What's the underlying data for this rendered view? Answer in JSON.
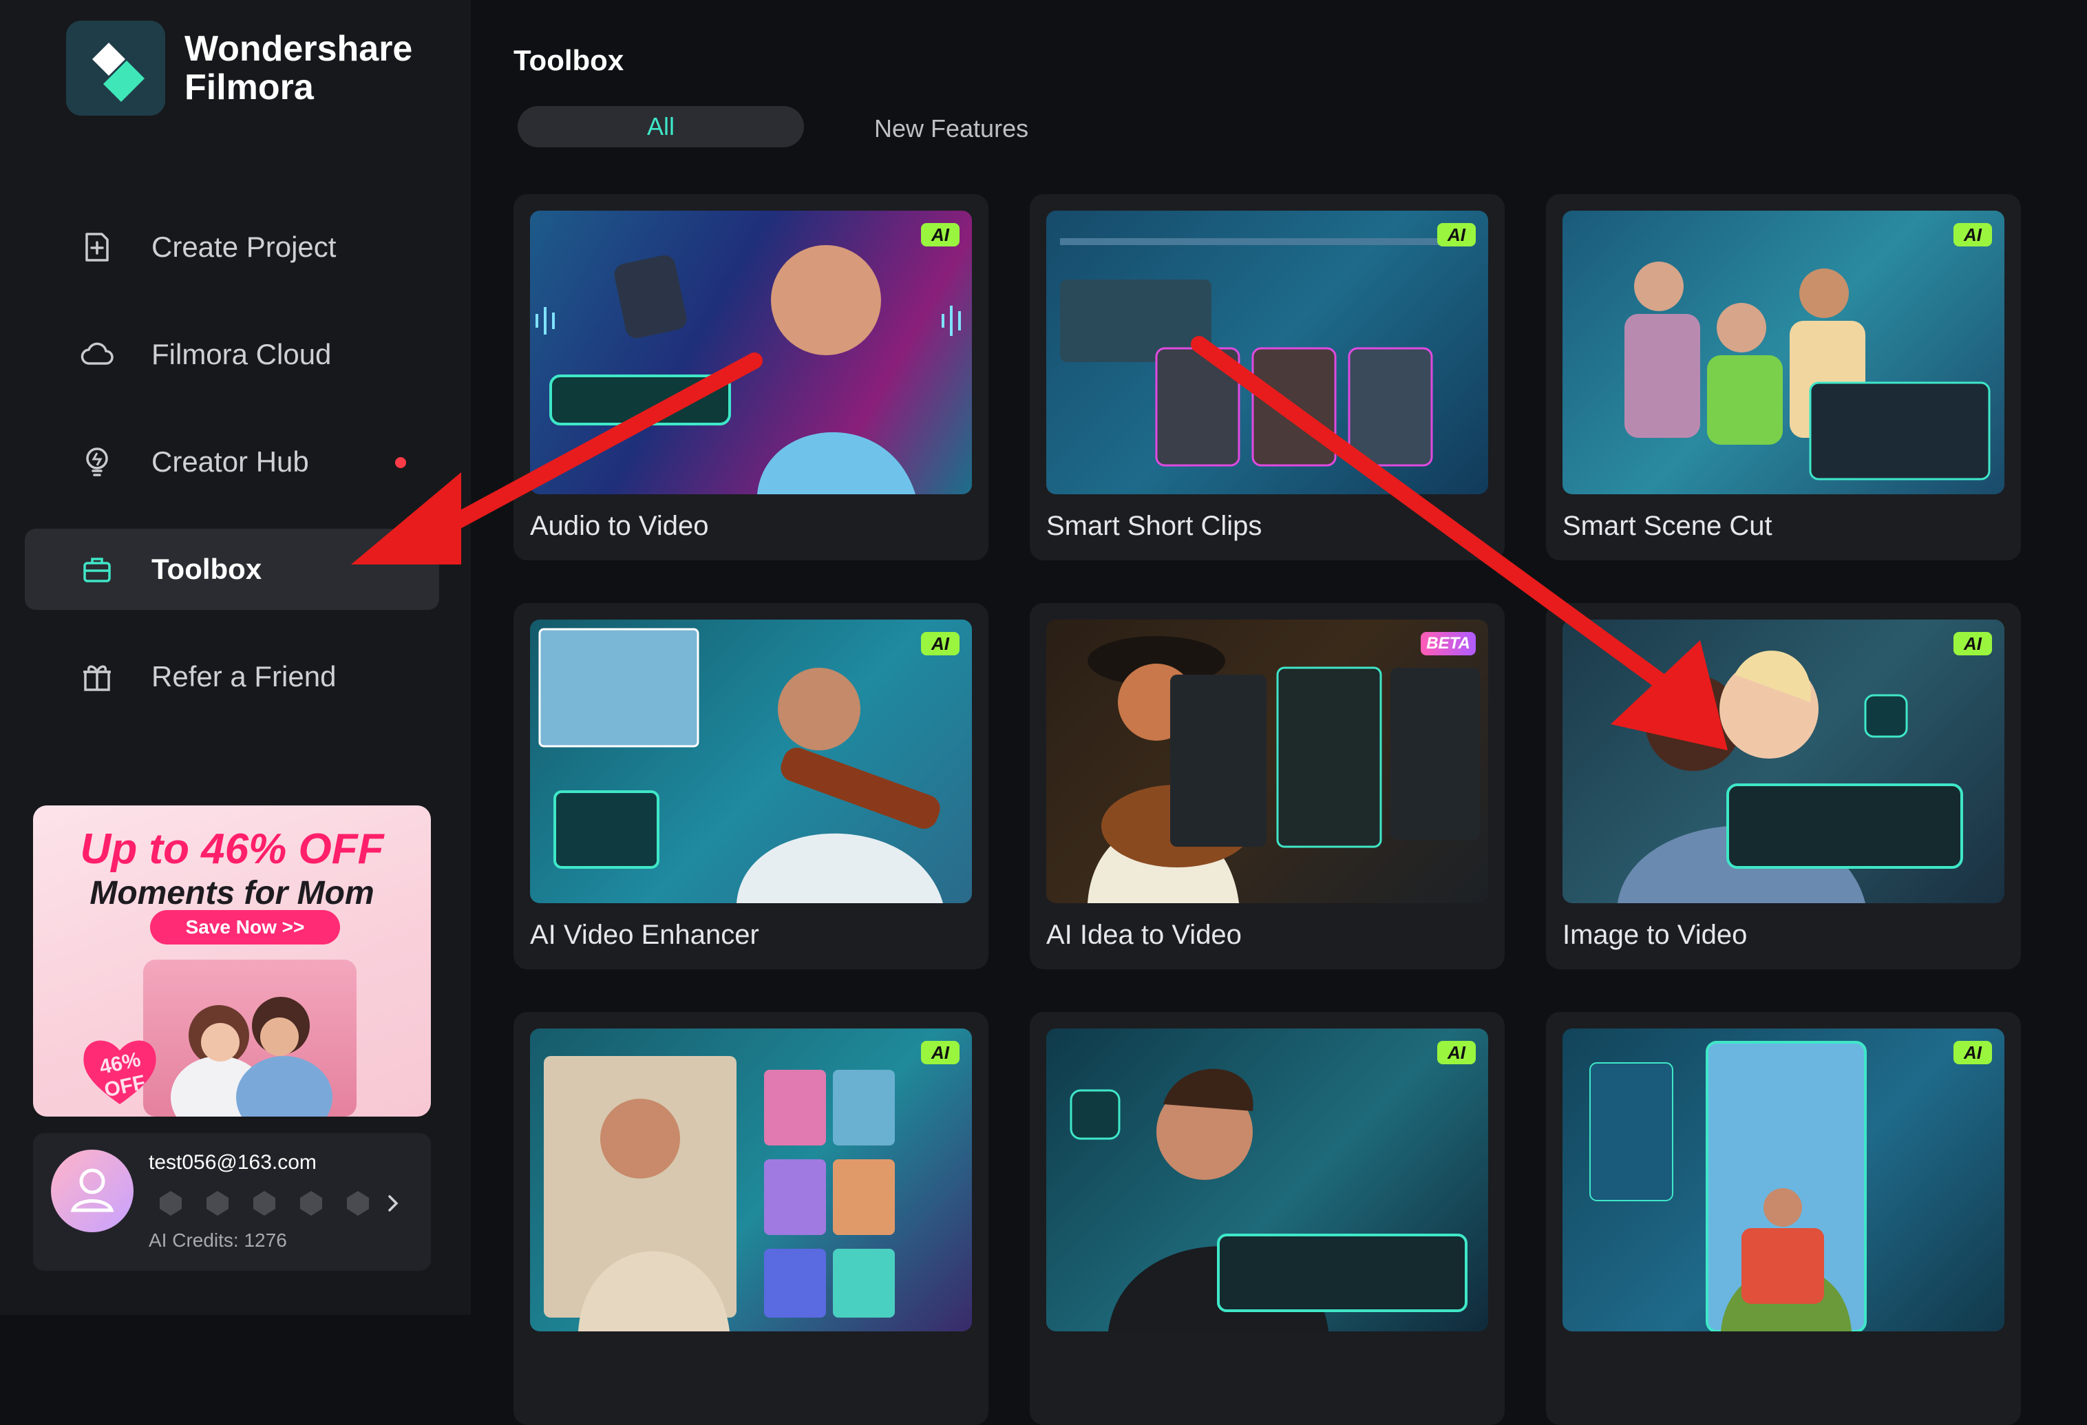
{
  "app": {
    "name": "Wondershare Filmora",
    "name_line1": "Wondershare",
    "name_line2": "Filmora"
  },
  "sidebar": {
    "items": [
      {
        "label": "Create Project",
        "icon": "plus-square-icon",
        "active": false
      },
      {
        "label": "Filmora Cloud",
        "icon": "cloud-icon",
        "active": false
      },
      {
        "label": "Creator Hub",
        "icon": "bulb-icon",
        "active": false,
        "notification": true
      },
      {
        "label": "Toolbox",
        "icon": "toolbox-icon",
        "active": true
      },
      {
        "label": "Refer a Friend",
        "icon": "gift-icon",
        "active": false
      }
    ],
    "promo": {
      "title": "Up to 46% OFF",
      "subtitle": "Moments for Mom",
      "button": "Save Now >>",
      "badge": "46% OFF"
    },
    "account": {
      "email": "test056@163.com",
      "credits": "AI Credits: 1276"
    }
  },
  "main": {
    "title": "Toolbox",
    "tabs": [
      {
        "label": "All",
        "active": true
      },
      {
        "label": "New Features",
        "active": false
      }
    ],
    "cards": [
      {
        "label": "Audio to Video",
        "badge": "AI"
      },
      {
        "label": "Smart Short Clips",
        "badge": "AI"
      },
      {
        "label": "Smart Scene Cut",
        "badge": "AI"
      },
      {
        "label": "AI Video Enhancer",
        "badge": "AI"
      },
      {
        "label": "AI Idea to Video",
        "badge": "BETA"
      },
      {
        "label": "Image to Video",
        "badge": "AI"
      },
      {
        "label": "",
        "badge": "AI"
      },
      {
        "label": "",
        "badge": "AI"
      },
      {
        "label": "",
        "badge": "AI"
      }
    ]
  },
  "colors": {
    "accent": "#3fe7c8",
    "annotation_arrow": "#e81c1c",
    "ai_badge": "#9af53f"
  }
}
